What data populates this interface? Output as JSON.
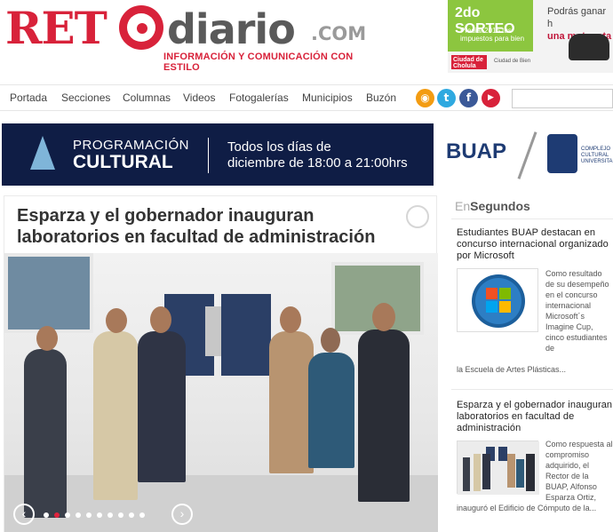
{
  "header": {
    "logo_ret": "RET",
    "logo_diario": "diario",
    "logo_com": ".COM",
    "tagline": "INFORMACIÓN Y COMUNICACIÓN CON ESTILO",
    "ad": {
      "sorteo": "2do SORTEO",
      "sorteo_sub": "Predial 2015 tus impuestos para bien",
      "text_line1": "Podrás ganar h",
      "text_line2": "una motoneta",
      "logo_city": "Ciudad de Cholula",
      "logo_tag": "Ciudad de Bien"
    }
  },
  "nav": {
    "items": [
      "Portada",
      "Secciones",
      "Columnas",
      "Videos",
      "Fotogalerías",
      "Municipios",
      "Buzón"
    ],
    "social": [
      {
        "icon": "rss-icon",
        "glyph": "◉",
        "color": "#f39c12"
      },
      {
        "icon": "twitter-icon",
        "glyph": "t",
        "color": "#2fa9e0"
      },
      {
        "icon": "facebook-icon",
        "glyph": "f",
        "color": "#3b5998"
      },
      {
        "icon": "youtube-icon",
        "glyph": "▶",
        "color": "#d8223a"
      }
    ],
    "search_placeholder": ""
  },
  "banner": {
    "title1": "PROGRAMACIÓN",
    "title2": "CULTURAL",
    "line1": "Todos los días de",
    "line2": "diciembre de 18:00 a 21:00hrs",
    "brand": "BUAP",
    "complejo": "COMPLEJO CULTURAL UNIVERSITARIO"
  },
  "article": {
    "title": "Esparza y el gobernador inauguran laboratorios en facultad de administración",
    "slider_prev": "‹",
    "slider_next": "›",
    "slider_dots": 10,
    "slider_active": 1
  },
  "sidebar": {
    "header_light": "En",
    "header_bold": "Segundos",
    "items": [
      {
        "title": "Estudiantes BUAP destacan en concurso internacional organizado por Microsoft",
        "text": "Como resultado de su desempeño en el concurso internacional Microsoft´s Imagine Cup, cinco estudiantes de",
        "cont": "la Escuela de Artes Plásticas..."
      },
      {
        "title": "Esparza y el gobernador inauguran laboratorios en facultad de administración",
        "text": "Como respuesta al compromiso adquirido, el Rector de la BUAP, Alfonso Esparza Ortiz,",
        "cont": "inauguró el Edificio de Cómputo de la..."
      }
    ]
  },
  "colors": {
    "brand_red": "#d8223a",
    "banner_navy": "#0f1d45",
    "nav_text": "#444444"
  }
}
